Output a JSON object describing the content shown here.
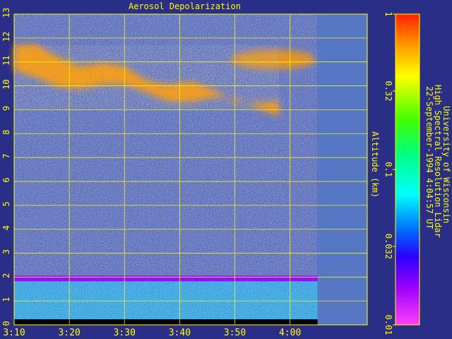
{
  "chart_data": {
    "type": "heatmap",
    "title": "Aerosol Depolarization",
    "ylabel": "Altitude (km)",
    "xlabel": "",
    "x_ticks": [
      "3:10",
      "3:20",
      "3:30",
      "3:40",
      "3:50",
      "4:00"
    ],
    "y_ticks": [
      0,
      1,
      2,
      3,
      4,
      5,
      6,
      7,
      8,
      9,
      10,
      11,
      12,
      13
    ],
    "xlim": [
      "3:10",
      "4:14"
    ],
    "ylim": [
      0,
      13
    ],
    "data_end": "4:05",
    "grid": true,
    "colorbar": {
      "ticks": [
        "1",
        "0.32",
        "0.1",
        "0.032",
        "0.01"
      ],
      "scale": "log",
      "range": [
        0.01,
        1
      ]
    },
    "features": [
      {
        "name": "cirrus layer",
        "x": [
          "3:10",
          "3:58"
        ],
        "y": [
          9,
          11.7
        ],
        "level": 0.5
      },
      {
        "name": "boundary layer",
        "x": [
          "3:10",
          "4:05"
        ],
        "y": [
          0,
          2
        ],
        "level": 0.03
      }
    ],
    "annotations": [
      "University of Wisconsin",
      "High Spectral Resolution Lidar",
      "22-September-1994  4:04:57 UT"
    ]
  },
  "colors": {
    "background": "#2b2e86",
    "text": "#ffff00",
    "grid": "#ffff00",
    "nodata": "#5577c4"
  }
}
